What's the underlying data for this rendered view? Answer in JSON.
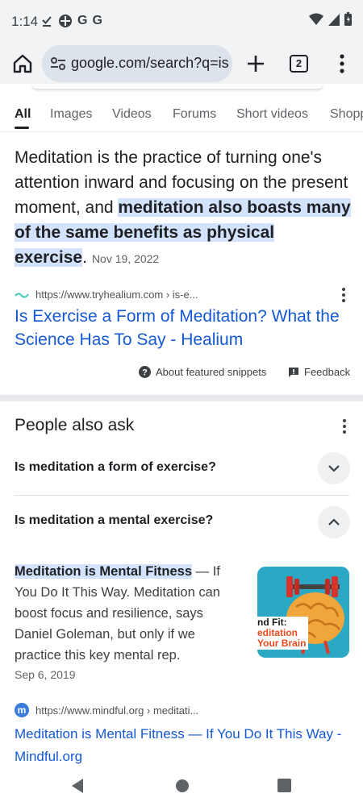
{
  "status_bar": {
    "time": "1:14",
    "notif_icons": [
      "download-done-icon",
      "game-controller-icon",
      "google-g-icon",
      "google-g-icon"
    ],
    "g1": "G",
    "g2": "G"
  },
  "toolbar": {
    "url": "google.com/search?q=is",
    "tab_count": "2"
  },
  "search_tabs": [
    {
      "label": "All"
    },
    {
      "label": "Images"
    },
    {
      "label": "Videos"
    },
    {
      "label": "Forums"
    },
    {
      "label": "Short videos"
    },
    {
      "label": "Shopping"
    }
  ],
  "snippet": {
    "text_plain_1": "Meditation is the practice of turning one's attention inward and focusing on the present moment, and ",
    "text_highlight": "meditation also boasts many of the same benefits as physical exercise",
    "text_plain_2": ".",
    "date": "Nov 19, 2022",
    "cite": "https://www.tryhealium.com › is-e...",
    "title": "Is Exercise a Form of Meditation? What the Science Has To Say - Healium",
    "about_label": "About featured snippets",
    "feedback_label": "Feedback"
  },
  "paa": {
    "title": "People also ask",
    "questions": [
      {
        "text": "Is meditation a form of exercise?",
        "expanded": false
      },
      {
        "text": "Is meditation a mental exercise?",
        "expanded": true
      }
    ],
    "answer": {
      "highlight": "Meditation is Mental Fitness",
      "text": " — If You Do It This Way. Meditation can boost focus and resilience, says Daniel Goleman, but only if we practice this key mental rep.",
      "date": "Sep 6, 2019",
      "thumb_text_1": "nd Fit:",
      "thumb_text_2": "editation",
      "thumb_text_3": "Your Brain",
      "cite": "https://www.mindful.org › meditati...",
      "title": "Meditation is Mental Fitness — If You Do It This Way - Mindful.org",
      "logo_letter": "m"
    }
  },
  "colors": {
    "link": "#1558d6",
    "highlight": "#d3e3fd",
    "accent_teal": "#2aa8c4"
  }
}
